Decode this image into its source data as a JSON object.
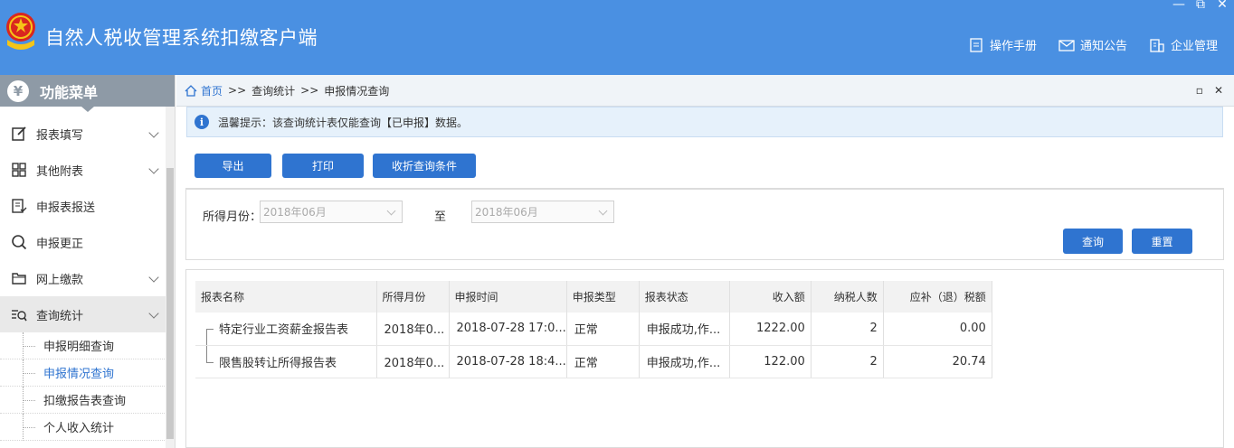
{
  "app": {
    "title": "自然人税收管理系统扣缴客户端"
  },
  "window_controls": [
    "—",
    "⧉",
    "✕"
  ],
  "top_links": [
    {
      "label": "操作手册",
      "icon": "manual-icon"
    },
    {
      "label": "通知公告",
      "icon": "mail-icon"
    },
    {
      "label": "企业管理",
      "icon": "building-icon"
    }
  ],
  "sidebar": {
    "header": "功能菜单",
    "items": [
      {
        "label": "报表填写",
        "icon": "edit-icon",
        "has_chevron": true
      },
      {
        "label": "其他附表",
        "icon": "grid-icon",
        "has_chevron": true
      },
      {
        "label": "申报表报送",
        "icon": "submit-doc-icon",
        "has_chevron": false
      },
      {
        "label": "申报更正",
        "icon": "search-icon",
        "has_chevron": false
      },
      {
        "label": "网上缴款",
        "icon": "folder-icon",
        "has_chevron": true
      },
      {
        "label": "查询统计",
        "icon": "list-search-icon",
        "has_chevron": true
      }
    ],
    "sub_items": [
      {
        "label": "申报明细查询"
      },
      {
        "label": "申报情况查询"
      },
      {
        "label": "扣缴报告表查询"
      },
      {
        "label": "个人收入统计"
      }
    ]
  },
  "breadcrumb": {
    "home": "首页",
    "sep": ">>",
    "level1": "查询统计",
    "level2": "申报情况查询"
  },
  "notice": {
    "text": "温馨提示：该查询统计表仅能查询【已申报】数据。"
  },
  "toolbar": {
    "export": "导出",
    "print": "打印",
    "collapse": "收折查询条件"
  },
  "query": {
    "month_label": "所得月份：",
    "from_value": "2018年06月",
    "to_label": "至",
    "to_value": "2018年06月",
    "search": "查询",
    "reset": "重置"
  },
  "table": {
    "columns": [
      "报表名称",
      "所得月份",
      "申报时间",
      "申报类型",
      "报表状态",
      "收入额",
      "纳税人数",
      "应补（退）税额"
    ],
    "rows": [
      [
        "特定行业工资薪金报告表",
        "2018年0...",
        "2018-07-28 17:0...",
        "正常",
        "申报成功,作...",
        "1222.00",
        "2",
        "0.00"
      ],
      [
        "限售股转让所得报告表",
        "2018年0...",
        "2018-07-28 18:4...",
        "正常",
        "申报成功,作...",
        "122.00",
        "2",
        "20.74"
      ]
    ]
  },
  "colors": {
    "titlebar": "#4a90e2",
    "accent": "#2f74d0",
    "sidebar_header": "#8e9aa6"
  }
}
